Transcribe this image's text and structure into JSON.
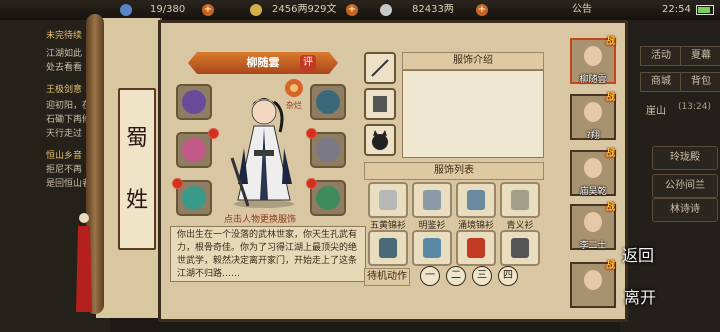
{
  "topbar": {
    "stamina": "19/380",
    "money": "2456两929文",
    "silver": "82433两",
    "announcement": "公告",
    "time": "22:54"
  },
  "quest_log": [
    {
      "text": "未完待续",
      "head": true
    },
    {
      "text": "江湖如此"
    },
    {
      "text": "处去看看"
    },
    {
      "text": "王极剑意",
      "head": true
    },
    {
      "text": "迎初阳，在"
    },
    {
      "text": "石磡下再修"
    },
    {
      "text": "天行走过"
    },
    {
      "text": "恒山乡音",
      "head": true
    },
    {
      "text": "拒尼不再"
    },
    {
      "text": "是回恒山者"
    }
  ],
  "right_menu": {
    "buttons": [
      "活动",
      "夏幕",
      "商城",
      "背包"
    ],
    "location": "崖山",
    "location_time": "(13:24)",
    "long_buttons": [
      "玲珑殿",
      "公孙间兰",
      "林诗诗"
    ]
  },
  "scroll": {
    "line1": "蜀",
    "line2": "姓"
  },
  "character": {
    "name": "柳随雲",
    "eval_badge": "评",
    "faction_badge": "杂烂",
    "caption": "点击人物更换服饰",
    "description": "你出生在一个没落的武林世家，你天生孔武有力，根骨奇佳。你为了习得江湖上最顶尖的绝世武学，毅然决定离开家门，开始走上了这条江湖不归路……"
  },
  "accessory_intro": {
    "title": "服饰介绍"
  },
  "outfit_list": {
    "title": "服饰列表",
    "items": [
      {
        "name": "五黄锦衫"
      },
      {
        "name": "明鉴衫"
      },
      {
        "name": "涌境锦衫"
      },
      {
        "name": "青义衫"
      },
      {
        "name": ""
      },
      {
        "name": ""
      },
      {
        "name": ""
      },
      {
        "name": ""
      }
    ]
  },
  "pose": {
    "label": "待机动作",
    "pages": [
      "一",
      "二",
      "三",
      "四"
    ]
  },
  "portraits": [
    {
      "name": "柳随雲",
      "selected": true
    },
    {
      "name": "?翔",
      "selected": false
    },
    {
      "name": "庙吴乾",
      "selected": false
    },
    {
      "name": "李二士",
      "selected": false
    },
    {
      "name": "",
      "selected": false
    }
  ],
  "overlay": {
    "back": "返回",
    "leave": "离开"
  },
  "badge_label": "战",
  "colors": {
    "accent": "#c23a24",
    "ribbon": "#c8682a",
    "parchment": "#d8c7a2"
  }
}
